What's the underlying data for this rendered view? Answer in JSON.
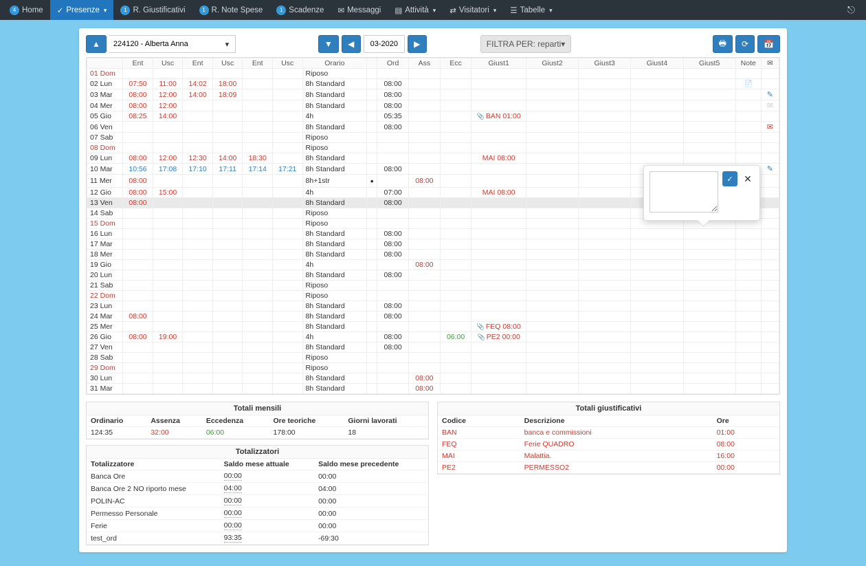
{
  "nav": {
    "home": "Home",
    "home_badge": "4",
    "presenze": "Presenze",
    "giustificativi": "R. Giustificativi",
    "giustificativi_badge": "1",
    "notespese": "R. Note Spese",
    "notespese_badge": "1",
    "scadenze": "Scadenze",
    "scadenze_badge": "1",
    "messaggi": "Messaggi",
    "attivita": "Attività",
    "visitatori": "Visitatori",
    "tabelle": "Tabelle"
  },
  "toolbar": {
    "employee": "224120 - Alberta Anna",
    "period": "03-2020",
    "filter": "FILTRA PER: reparti",
    "filter_caret": "▾"
  },
  "headers": {
    "ent": "Ent",
    "usc": "Usc",
    "orario": "Orario",
    "ord": "Ord",
    "ass": "Ass",
    "ecc": "Ecc",
    "g1": "Giust1",
    "g2": "Giust2",
    "g3": "Giust3",
    "g4": "Giust4",
    "g5": "Giust5",
    "note": "Note",
    "mail": "✉"
  },
  "rows": [
    {
      "day": "01 Dom",
      "weekend": true,
      "orario": "Riposo"
    },
    {
      "day": "02 Lun",
      "t": [
        [
          "07:50",
          "red"
        ],
        [
          "11:00",
          "red"
        ],
        [
          "14:02",
          "red"
        ],
        [
          "18:00",
          "red"
        ]
      ],
      "orario": "8h Standard",
      "ord": "08:00",
      "note": "note"
    },
    {
      "day": "03 Mar",
      "t": [
        [
          "08:00",
          "red"
        ],
        [
          "12:00",
          "red"
        ],
        [
          "14:00",
          "red"
        ],
        [
          "18:09",
          "red"
        ]
      ],
      "orario": "8h Standard",
      "ord": "08:00",
      "pencil": true
    },
    {
      "day": "04 Mer",
      "t": [
        [
          "08:00",
          "red"
        ],
        [
          "12:00",
          "red"
        ]
      ],
      "orario": "8h Standard",
      "ord": "08:00",
      "env": "grey"
    },
    {
      "day": "05 Gio",
      "t": [
        [
          "08:25",
          "red"
        ],
        [
          "14:00",
          "red"
        ]
      ],
      "orario": "4h",
      "ord": "05:35",
      "g1": "BAN 01:00",
      "g1clip": true
    },
    {
      "day": "06 Ven",
      "orario": "8h Standard",
      "ord": "08:00",
      "env": "red"
    },
    {
      "day": "07 Sab",
      "orario": "Riposo"
    },
    {
      "day": "08 Dom",
      "weekend": true,
      "orario": "Riposo"
    },
    {
      "day": "09 Lun",
      "t": [
        [
          "08:00",
          "red"
        ],
        [
          "12:00",
          "red"
        ],
        [
          "12:30",
          "red"
        ],
        [
          "14:00",
          "red"
        ],
        [
          "18:30",
          "red"
        ]
      ],
      "orario": "8h Standard",
      "g1": "MAI 08:00"
    },
    {
      "day": "10 Mar",
      "t": [
        [
          "10:56",
          "blue"
        ],
        [
          "17:08",
          "blue"
        ],
        [
          "17:10",
          "blue"
        ],
        [
          "17:11",
          "blue"
        ],
        [
          "17:14",
          "blue"
        ],
        [
          "17:21",
          "blue"
        ]
      ],
      "orario": "8h Standard",
      "ord": "08:00",
      "pencil": true
    },
    {
      "day": "11 Mer",
      "t": [
        [
          "08:00",
          "red"
        ]
      ],
      "orario": "8h+1str",
      "dot": true,
      "ass": "08:00"
    },
    {
      "day": "12 Gio",
      "t": [
        [
          "08:00",
          "red"
        ],
        [
          "15:00",
          "red"
        ]
      ],
      "orario": "4h",
      "ord": "07:00",
      "g1": "MAI 08:00"
    },
    {
      "day": "13 Ven",
      "hl": true,
      "t": [
        [
          "08:00",
          "red"
        ]
      ],
      "orario": "8h Standard",
      "ord": "08:00"
    },
    {
      "day": "14 Sab",
      "orario": "Riposo"
    },
    {
      "day": "15 Dom",
      "weekend": true,
      "orario": "Riposo"
    },
    {
      "day": "16 Lun",
      "orario": "8h Standard",
      "ord": "08:00"
    },
    {
      "day": "17 Mar",
      "orario": "8h Standard",
      "ord": "08:00"
    },
    {
      "day": "18 Mer",
      "orario": "8h Standard",
      "ord": "08:00"
    },
    {
      "day": "19 Gio",
      "orario": "4h",
      "ass": "08:00"
    },
    {
      "day": "20 Lun",
      "orario": "8h Standard",
      "ord": "08:00"
    },
    {
      "day": "21 Sab",
      "orario": "Riposo"
    },
    {
      "day": "22 Dom",
      "weekend": true,
      "orario": "Riposo"
    },
    {
      "day": "23 Lun",
      "orario": "8h Standard",
      "ord": "08:00"
    },
    {
      "day": "24 Mar",
      "t": [
        [
          "08:00",
          "red"
        ]
      ],
      "orario": "8h Standard",
      "ord": "08:00"
    },
    {
      "day": "25 Mer",
      "orario": "8h Standard",
      "g1": "FEQ 08:00",
      "g1clip": true
    },
    {
      "day": "26 Gio",
      "t": [
        [
          "08:00",
          "red"
        ],
        [
          "19:00",
          "red"
        ]
      ],
      "orario": "4h",
      "ord": "08:00",
      "ecc": "06:00",
      "g1": "PE2 00:00",
      "g1clip": true
    },
    {
      "day": "27 Ven",
      "orario": "8h Standard",
      "ord": "08:00"
    },
    {
      "day": "28 Sab",
      "orario": "Riposo"
    },
    {
      "day": "29 Dom",
      "weekend": true,
      "orario": "Riposo"
    },
    {
      "day": "30 Lun",
      "orario": "8h Standard",
      "ass": "08:00"
    },
    {
      "day": "31 Mar",
      "orario": "8h Standard",
      "ass": "08:00"
    }
  ],
  "mensili": {
    "title": "Totali mensili",
    "h": {
      "ord": "Ordinario",
      "ass": "Assenza",
      "ecc": "Eccedenza",
      "teo": "Ore teoriche",
      "gl": "Giorni lavorati"
    },
    "v": {
      "ord": "124:35",
      "ass": "32:00",
      "ecc": "06:00",
      "teo": "178:00",
      "gl": "18"
    }
  },
  "totalizzatori": {
    "title": "Totalizzatori",
    "h": {
      "nome": "Totalizzatore",
      "att": "Saldo mese attuale",
      "prec": "Saldo mese precedente"
    },
    "rows": [
      {
        "n": "Banca Ore",
        "a": "00:00",
        "p": "00:00"
      },
      {
        "n": "Banca Ore 2 NO riporto mese",
        "a": "04:00",
        "p": "04:00"
      },
      {
        "n": "POLIN-AC",
        "a": "00:00",
        "p": "00:00"
      },
      {
        "n": "Permesso Personale",
        "a": "00:00",
        "p": "00:00"
      },
      {
        "n": "Ferie",
        "a": "00:00",
        "p": "00:00"
      },
      {
        "n": "test_ord",
        "a": "93:35",
        "p": "-69:30"
      }
    ]
  },
  "giustificativi": {
    "title": "Totali giustificativi",
    "h": {
      "c": "Codice",
      "d": "Descrizione",
      "o": "Ore"
    },
    "rows": [
      {
        "c": "BAN",
        "d": "banca e commissioni",
        "o": "01:00"
      },
      {
        "c": "FEQ",
        "d": "Ferie QUADRO",
        "o": "08:00"
      },
      {
        "c": "MAI",
        "d": "Malattia.",
        "o": "16:00"
      },
      {
        "c": "PE2",
        "d": "PERMESSO2",
        "o": "00:00"
      }
    ]
  }
}
